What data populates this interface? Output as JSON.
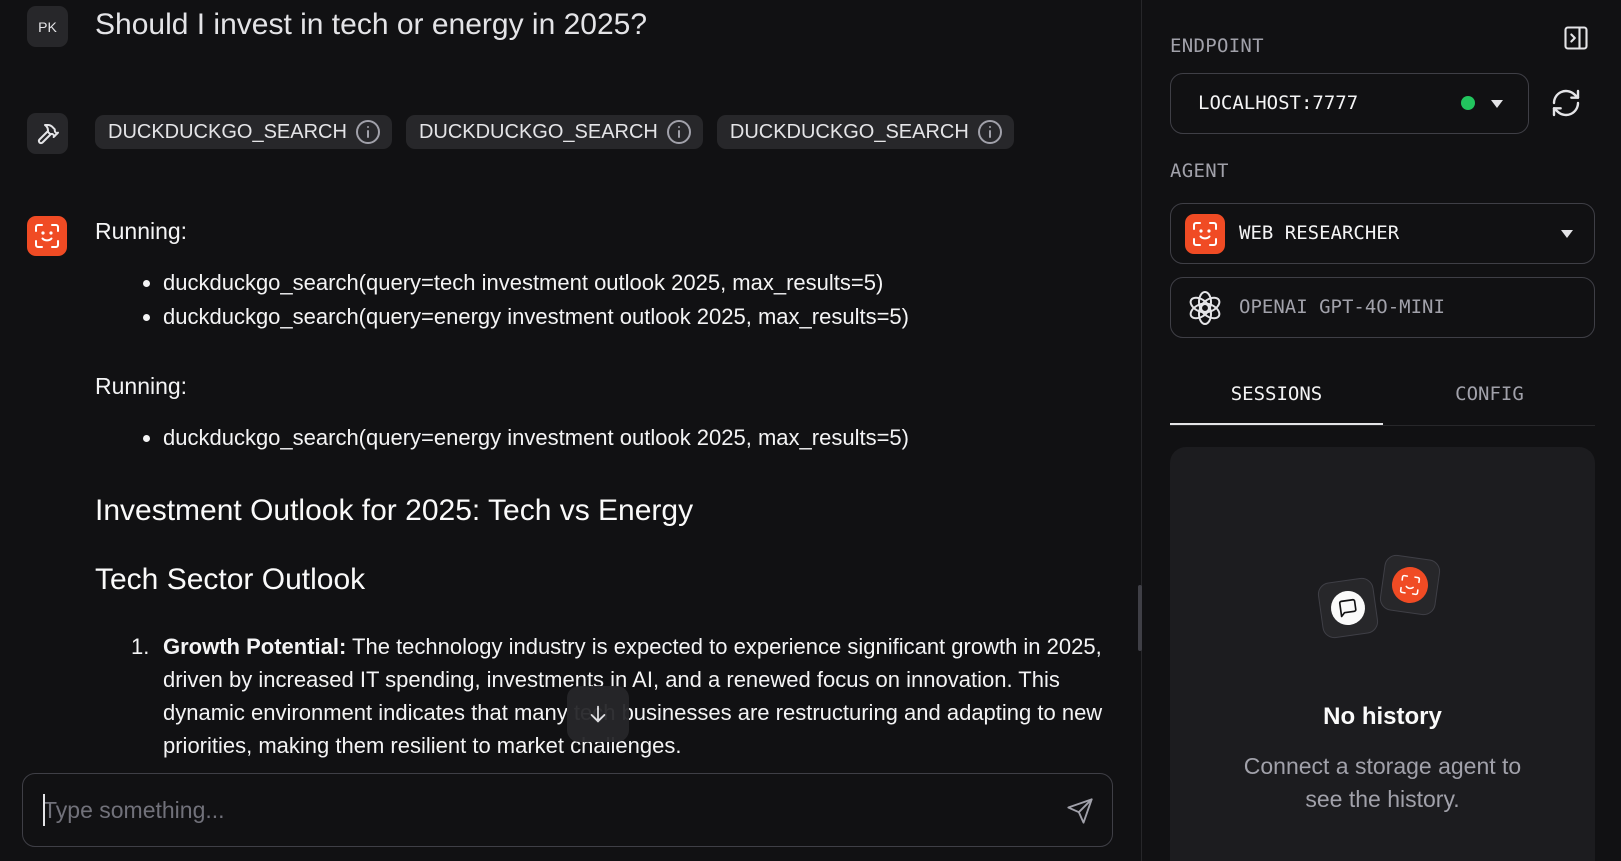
{
  "chat": {
    "user_initials": "PK",
    "question": "Should I invest in tech or energy in 2025?",
    "tool_chips": [
      "DUCKDUCKGO_SEARCH",
      "DUCKDUCKGO_SEARCH",
      "DUCKDUCKGO_SEARCH"
    ],
    "response": {
      "running_label_1": "Running:",
      "calls_1": [
        "duckduckgo_search(query=tech investment outlook 2025, max_results=5)",
        "duckduckgo_search(query=energy investment outlook 2025, max_results=5)"
      ],
      "running_label_2": "Running:",
      "calls_2": [
        "duckduckgo_search(query=energy investment outlook 2025, max_results=5)"
      ],
      "heading": "Investment Outlook for 2025: Tech vs Energy",
      "subheading": "Tech Sector Outlook",
      "list_items": [
        {
          "number": "1.",
          "bold": "Growth Potential:",
          "text": " The technology industry is expected to experience significant growth in 2025, driven by increased IT spending, investments in AI, and a renewed focus on innovation. This dynamic environment indicates that many tech businesses are restructuring and adapting to new priorities, making them resilient to market challenges."
        }
      ]
    }
  },
  "composer": {
    "placeholder": "Type something..."
  },
  "sidebar": {
    "endpoint_label": "ENDPOINT",
    "endpoint_value": "LOCALHOST:7777",
    "endpoint_status_color": "#22c55e",
    "agent_label": "AGENT",
    "agent_name": "WEB RESEARCHER",
    "model_name": "OPENAI GPT-4O-MINI",
    "tabs": [
      "SESSIONS",
      "CONFIG"
    ],
    "active_tab": "SESSIONS",
    "history_title": "No history",
    "history_desc": "Connect a storage agent to see the history."
  },
  "colors": {
    "background": "#111113",
    "accent": "#f04b24",
    "surface": "#27272a"
  },
  "icons": {
    "tools": "hammer-icon",
    "agent": "agent-face-icon",
    "info": "info-icon",
    "scroll": "arrow-down-icon",
    "send": "send-icon",
    "collapse": "sidebar-collapse-icon",
    "refresh": "refresh-icon",
    "model": "openai-logo-icon",
    "chat": "chat-bubble-icon"
  }
}
